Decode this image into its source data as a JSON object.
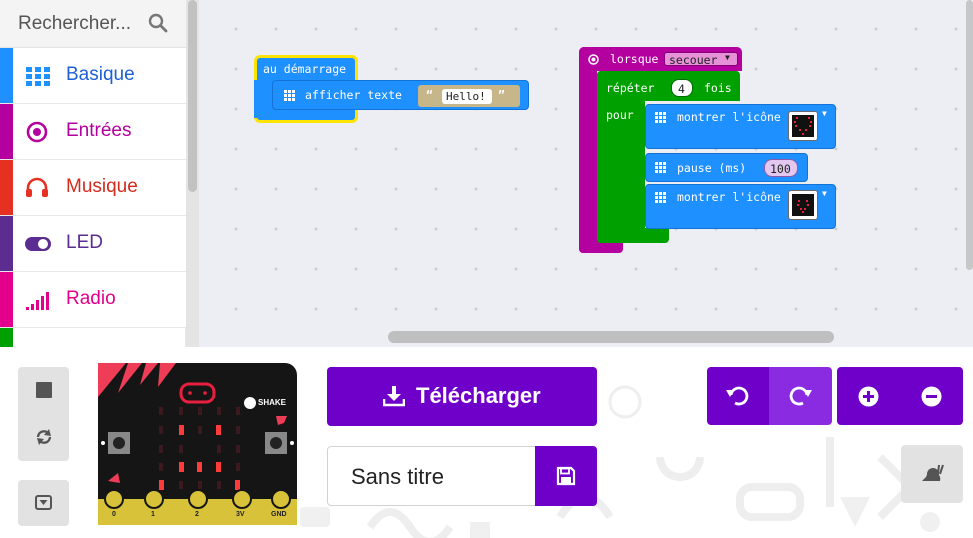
{
  "search": {
    "placeholder": "Rechercher..."
  },
  "categories": [
    {
      "label": "Basique",
      "color": "#1e90ff",
      "icon": "grid-icon"
    },
    {
      "label": "Entrées",
      "color": "#b4009e",
      "icon": "radio-target-icon"
    },
    {
      "label": "Musique",
      "color": "#e63022",
      "icon": "headphones-icon"
    },
    {
      "label": "LED",
      "color": "#5c2d91",
      "icon": "toggle-icon"
    },
    {
      "label": "Radio",
      "color": "#e3008c",
      "icon": "signal-bars-icon"
    }
  ],
  "blocks": {
    "on_start": {
      "label": "au démarrage",
      "show_string": "afficher texte",
      "string_value": "Hello!"
    },
    "on_gesture": {
      "label": "lorsque",
      "gesture": "secouer"
    },
    "repeat": {
      "label": "répéter",
      "count": "4",
      "times": "fois",
      "do": "pour"
    },
    "show_icon_1": {
      "label": "montrer l'icône"
    },
    "pause": {
      "label": "pause (ms)",
      "value": "100"
    },
    "show_icon_2": {
      "label": "montrer l'icône"
    }
  },
  "simulator": {
    "shake_label": "SHAKE",
    "pins": [
      "0",
      "1",
      "2",
      "3V",
      "GND"
    ]
  },
  "toolbar": {
    "download_label": "Télécharger",
    "project_title": "Sans titre"
  },
  "colors": {
    "basic": "#1e90ff",
    "input": "#b4009e",
    "loops": "#00a000",
    "accent": "#6f00c9",
    "string": "#c8b68b",
    "led": "#e81f3f"
  }
}
